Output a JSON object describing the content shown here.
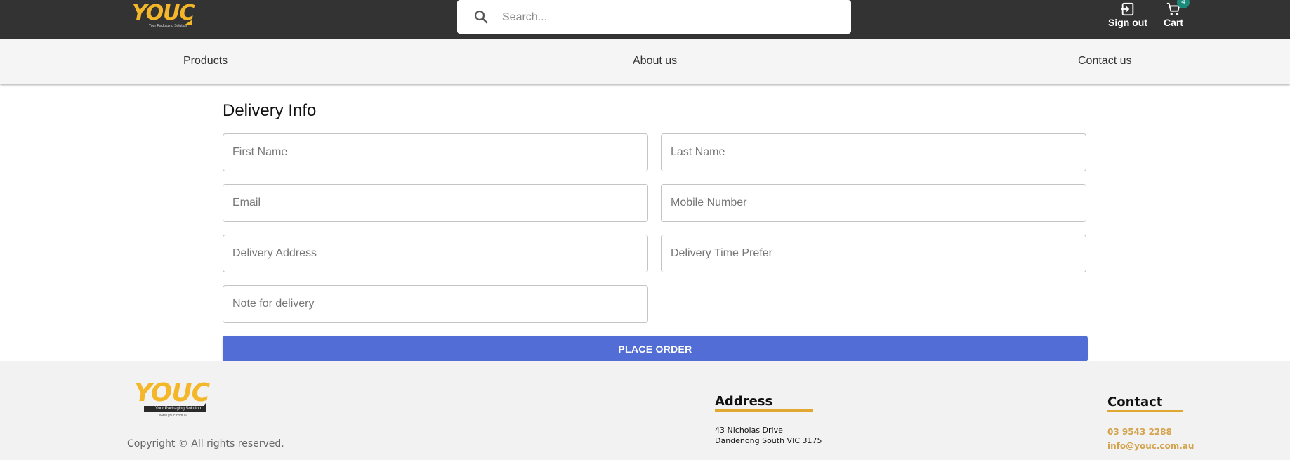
{
  "header": {
    "logo_text": "YOUC",
    "logo_tagline": "Your Packaging Solution",
    "search_placeholder": "Search...",
    "sign_out_label": "Sign out",
    "cart_label": "Cart",
    "cart_count": "4"
  },
  "nav": {
    "items": [
      {
        "label": "Products"
      },
      {
        "label": "About us"
      },
      {
        "label": "Contact us"
      }
    ]
  },
  "form": {
    "title": "Delivery Info",
    "fields": {
      "first_name": "First Name",
      "last_name": "Last Name",
      "email": "Email",
      "mobile": "Mobile Number",
      "address": "Delivery Address",
      "time": "Delivery Time Prefer",
      "note": "Note for delivery"
    },
    "submit_label": "PLACE ORDER"
  },
  "footer": {
    "logo_text": "YOUC",
    "logo_tagline": "Your Packaging Solution",
    "logo_url": "www.youc.com.au",
    "copyright": "Copyright © All rights reserved.",
    "address_heading": "Address",
    "address_line1": "43 Nicholas Drive",
    "address_line2": "Dandenong South VIC 3175",
    "contact_heading": "Contact",
    "phone": "03 9543 2288",
    "email": "info@youc.com.au"
  },
  "colors": {
    "header_bg": "#333333",
    "brand_yellow": "#f5b72a",
    "button_blue": "#536dd6",
    "badge_teal": "#1a8a7a",
    "contact_gold": "#d4a24a"
  },
  "icons": {
    "search": "search-icon",
    "sign_out": "sign-out-icon",
    "cart": "cart-icon"
  }
}
